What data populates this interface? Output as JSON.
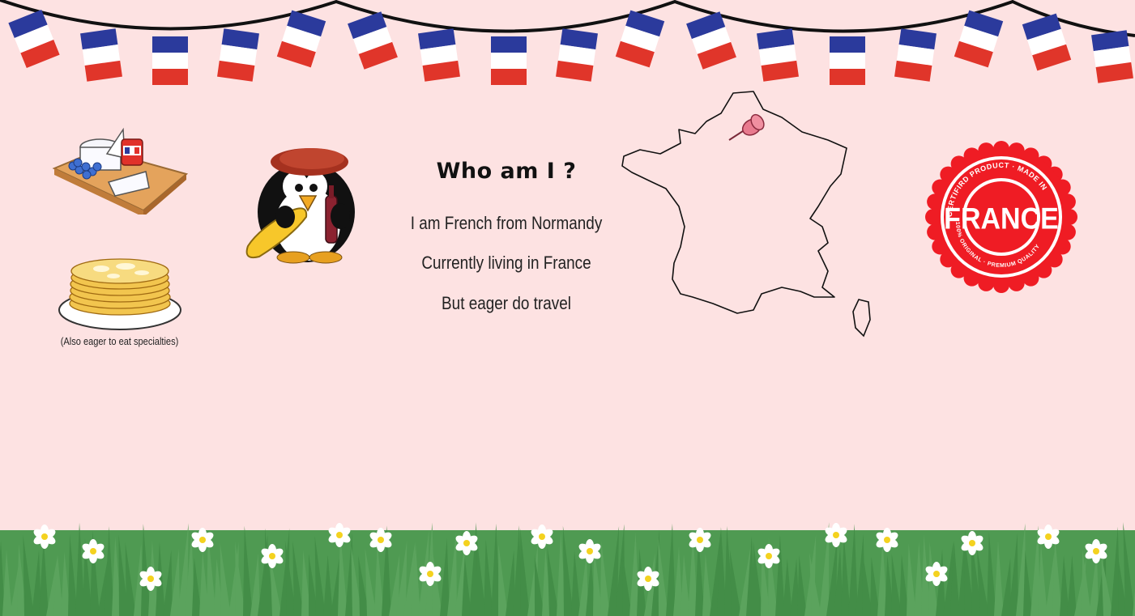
{
  "heading": "Who am I ?",
  "lines": [
    "I am French from Normandy",
    "Currently living in France",
    "But eager do travel"
  ],
  "food_caption": "(Also eager to eat specialties)",
  "badge": {
    "main": "FRANCE",
    "top_arc": "CERTIFIRD PRODUCT · MADE IN",
    "bottom_arc": "100% ORIGINAL · PREMIUM QUALITY"
  },
  "colors": {
    "background": "#fde2e2",
    "flag_blue": "#2b3a9c",
    "flag_white": "#ffffff",
    "flag_red": "#e0352a",
    "grass": "#4f9a52",
    "badge_red": "#ef1c24"
  },
  "icons": [
    "bunting-flags",
    "cheese-board",
    "crepes-plate",
    "penguin-mascot",
    "france-map",
    "map-pin",
    "certified-badge",
    "grass-with-daisies"
  ]
}
